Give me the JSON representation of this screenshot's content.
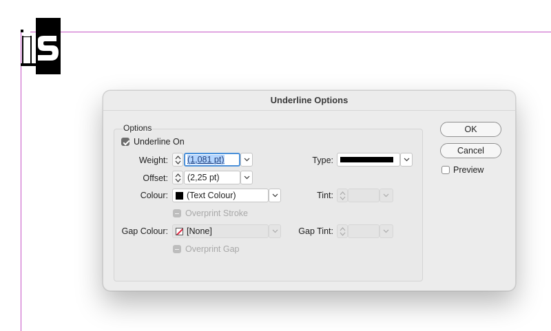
{
  "document": {
    "text_fragment": "is"
  },
  "dialog": {
    "title": "Underline Options",
    "options_group_label": "Options",
    "underline_on": {
      "label": "Underline On",
      "checked": true
    },
    "weight": {
      "label": "Weight:",
      "value": "(1,081 pt)"
    },
    "offset": {
      "label": "Offset:",
      "value": "(2,25 pt)"
    },
    "type": {
      "label": "Type:",
      "value_icon": "solid-line"
    },
    "colour": {
      "label": "Colour:",
      "value": "(Text Colour)",
      "swatch": "#000000"
    },
    "tint": {
      "label": "Tint:",
      "value": ""
    },
    "overprint_stroke": {
      "label": "Overprint Stroke",
      "enabled": false
    },
    "gap_colour": {
      "label": "Gap Colour:",
      "value": "[None]",
      "swatch": "none-swatch"
    },
    "gap_tint": {
      "label": "Gap Tint:",
      "value": ""
    },
    "overprint_gap": {
      "label": "Overprint Gap",
      "enabled": false
    },
    "buttons": {
      "ok": "OK",
      "cancel": "Cancel"
    },
    "preview": {
      "label": "Preview",
      "checked": false
    }
  },
  "colors": {
    "guide": "#c44fc4",
    "focus": "#4a90d9",
    "dialog_bg": "#ececec"
  }
}
